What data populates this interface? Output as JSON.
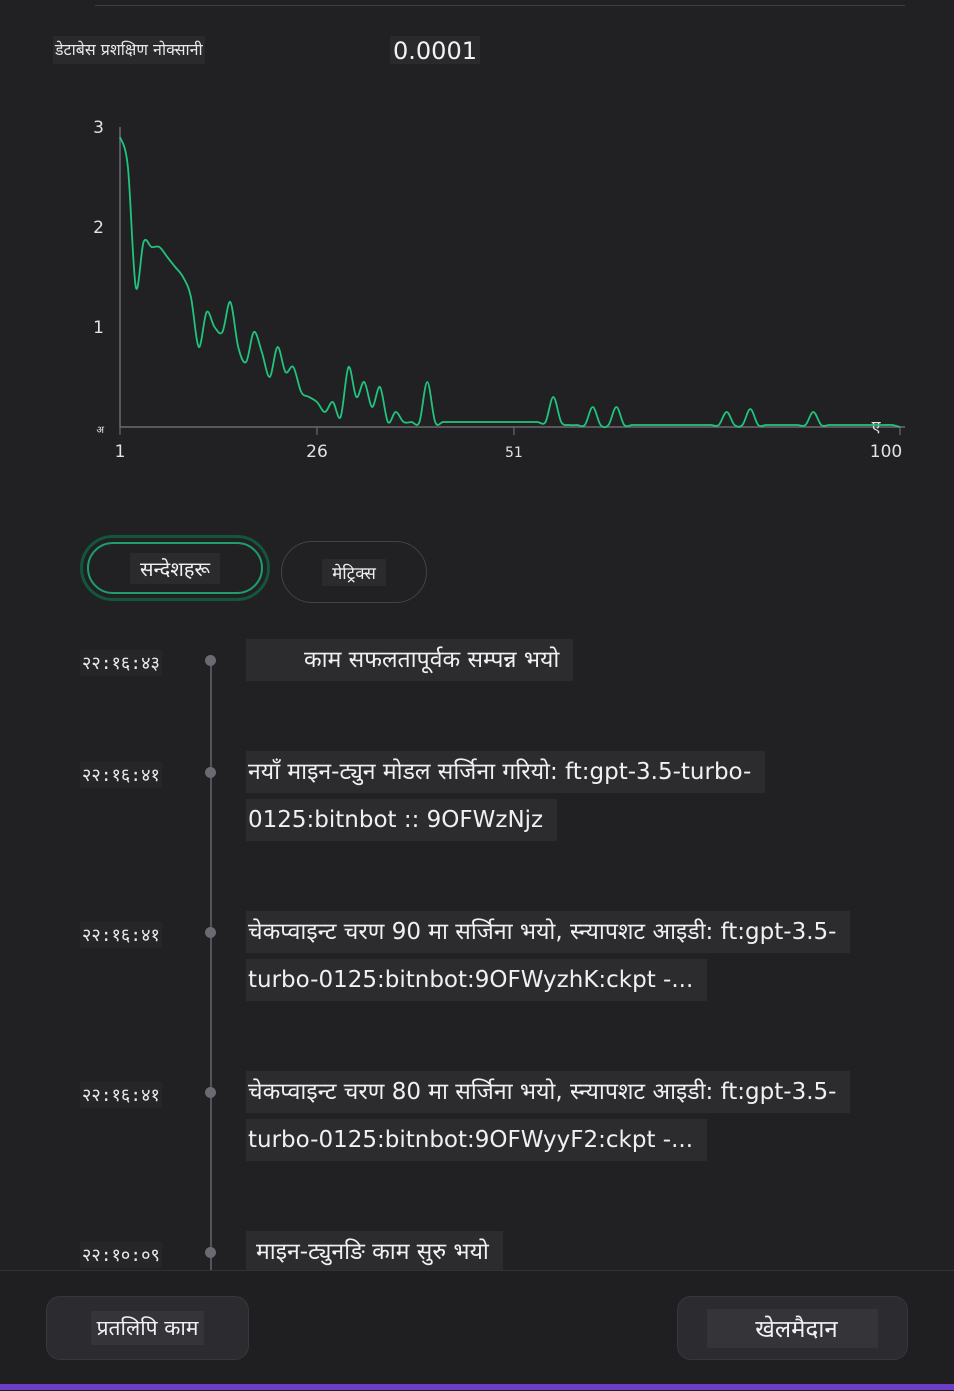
{
  "metric": {
    "label": "डेटाबेस प्रशक्षिण नोक्सानी",
    "value": "0.0001"
  },
  "chart_data": {
    "type": "line",
    "series": [
      {
        "color": "#20c47c",
        "x": [
          1,
          2,
          3,
          4,
          5,
          6,
          7,
          8,
          9,
          10,
          11,
          12,
          13,
          14,
          15,
          16,
          17,
          18,
          19,
          20,
          21,
          22,
          23,
          24,
          25,
          26,
          27,
          28,
          29,
          30,
          31,
          32,
          33,
          34,
          35,
          36,
          37,
          38,
          39,
          40,
          41,
          42,
          43,
          44,
          45,
          46,
          47,
          48,
          49,
          50,
          51,
          52,
          53,
          54,
          55,
          56,
          57,
          58,
          59,
          60,
          61,
          62,
          63,
          64,
          65,
          66,
          67,
          68,
          69,
          70,
          71,
          72,
          73,
          74,
          75,
          76,
          77,
          78,
          79,
          80,
          81,
          82,
          83,
          84,
          85,
          86,
          87,
          88,
          89,
          90,
          91,
          92,
          93,
          94,
          95,
          96,
          97,
          98,
          99,
          100
        ],
        "values": [
          2.9,
          2.6,
          1.4,
          1.85,
          1.8,
          1.8,
          1.7,
          1.6,
          1.5,
          1.3,
          0.8,
          1.15,
          1.0,
          0.95,
          1.25,
          0.8,
          0.65,
          0.95,
          0.75,
          0.5,
          0.8,
          0.55,
          0.6,
          0.35,
          0.3,
          0.25,
          0.15,
          0.25,
          0.1,
          0.6,
          0.3,
          0.45,
          0.2,
          0.4,
          0.05,
          0.15,
          0.05,
          0.05,
          0.05,
          0.45,
          0.05,
          0.05,
          0.05,
          0.05,
          0.05,
          0.05,
          0.05,
          0.05,
          0.05,
          0.05,
          0.05,
          0.05,
          0.05,
          0.05,
          0.05,
          0.3,
          0.05,
          0.02,
          0.02,
          0.02,
          0.2,
          0.02,
          0.02,
          0.2,
          0.02,
          0.02,
          0.02,
          0.02,
          0.02,
          0.02,
          0.02,
          0.02,
          0.02,
          0.02,
          0.02,
          0.02,
          0.02,
          0.15,
          0.02,
          0.02,
          0.18,
          0.02,
          0.02,
          0.02,
          0.02,
          0.02,
          0.02,
          0.02,
          0.15,
          0.02,
          0.02,
          0.02,
          0.02,
          0.02,
          0.02,
          0.02,
          0.02,
          0.02,
          0.02,
          0.0001
        ]
      }
    ],
    "x_ticks": [
      "1",
      "26",
      "51",
      "100"
    ],
    "y_ticks": [
      "अ",
      "1",
      "2",
      "3"
    ],
    "x_end_label": "ए",
    "xlim": [
      1,
      100
    ],
    "ylim": [
      0,
      3
    ],
    "grid": false
  },
  "tabs": {
    "messages": "सन्देशहरू",
    "metrics": "मेट्रिक्स"
  },
  "events": [
    {
      "time": "२२:१६:४३",
      "message": "काम सफलतापूर्वक सम्पन्न भयो"
    },
    {
      "time": "२२:१६:४१",
      "message": "नयाँ माइन-ट्युन मोडल सर्जिना गरियो: ft:gpt-3.5-turbo-0125:bitnbot :: 9OFWzNjz"
    },
    {
      "time": "२२:१६:४१",
      "message": "चेकप्वाइन्ट चरण 90 मा सर्जिना भयो, स्न्यापशट आइडी: ft:gpt-3.5-turbo-0125:bitnbot:9OFWyzhK:ckpt -..."
    },
    {
      "time": "२२:१६:४१",
      "message": "चेकप्वाइन्ट चरण 80 मा सर्जिना भयो, स्न्यापशट आइडी: ft:gpt-3.5-turbo-0125:bitnbot:9OFWyyF2:ckpt -..."
    },
    {
      "time": "२२:१०:०९",
      "message": "माइन-ट्युनङि काम सुरु भयो"
    }
  ],
  "buttons": {
    "copy": "प्रतलिपि काम",
    "playground": "खेलमैदान"
  }
}
